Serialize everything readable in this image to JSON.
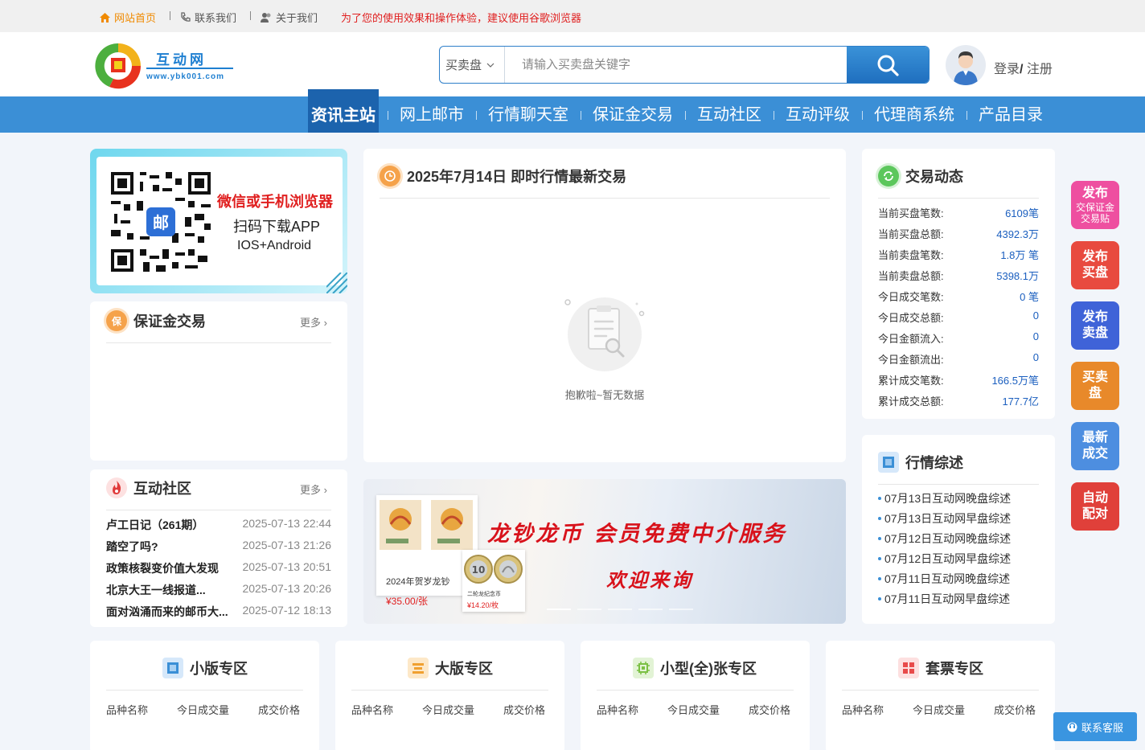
{
  "topbar": {
    "home": "网站首页",
    "contact": "联系我们",
    "about": "关于我们",
    "notice": "为了您的使用效果和操作体验，建议使用谷歌浏览器"
  },
  "logo": {
    "name": "互动网",
    "url": "www.ybk001.com"
  },
  "search": {
    "scope": "买卖盘",
    "placeholder": "请输入买卖盘关键字"
  },
  "user": {
    "login": "登录",
    "sep": "/",
    "register": "注册"
  },
  "nav": [
    "资讯主站",
    "网上邮市",
    "行情聊天室",
    "保证金交易",
    "互动社区",
    "互动评级",
    "代理商系统",
    "产品目录"
  ],
  "qr_card": {
    "line1": "微信或手机浏览器",
    "line2": "扫码下载APP",
    "line3": "IOS+Android"
  },
  "margin_trade": {
    "title": "保证金交易",
    "more": "更多",
    "icon_text": "保"
  },
  "community": {
    "title": "互动社区",
    "more": "更多",
    "posts": [
      {
        "title": "卢工日记（261期）",
        "date": "2025-07-13 22:44"
      },
      {
        "title": "踏空了吗?",
        "date": "2025-07-13 21:26"
      },
      {
        "title": "政策核裂变价值大发现",
        "date": "2025-07-13 20:51"
      },
      {
        "title": "北京大王一线报道...",
        "date": "2025-07-13 20:26"
      },
      {
        "title": "面对汹涌而来的邮币大...",
        "date": "2025-07-12 18:13"
      }
    ]
  },
  "realtime": {
    "title": "2025年7月14日 即时行情最新交易",
    "empty": "抱歉啦~暂无数据"
  },
  "trade_stats": {
    "title": "交易动态",
    "rows": [
      {
        "k": "当前买盘笔数:",
        "v": "6109笔"
      },
      {
        "k": "当前买盘总额:",
        "v": "4392.3万"
      },
      {
        "k": "当前卖盘笔数:",
        "v": "1.8万 笔"
      },
      {
        "k": "当前卖盘总额:",
        "v": "5398.1万"
      },
      {
        "k": "今日成交笔数:",
        "v": "0 笔"
      },
      {
        "k": "今日成交总额:",
        "v": "0"
      },
      {
        "k": "今日金额流入:",
        "v": "0"
      },
      {
        "k": "今日金额流出:",
        "v": "0"
      },
      {
        "k": "累计成交笔数:",
        "v": "166.5万笔"
      },
      {
        "k": "累计成交总额:",
        "v": "177.7亿"
      }
    ]
  },
  "market_review": {
    "title": "行情综述",
    "items": [
      "07月13日互动网晚盘综述",
      "07月13日互动网早盘综述",
      "07月12日互动网晚盘综述",
      "07月12日互动网早盘综述",
      "07月11日互动网晚盘综述",
      "07月11日互动网早盘综述"
    ]
  },
  "banner": {
    "headline": "龙钞龙币 会员免费中介服务",
    "sub": "欢迎来询",
    "item1_name": "2024年贺岁龙钞",
    "item1_price": "¥35.00/张",
    "item2_name": "二轮龙纪念币",
    "item2_price": "¥14.20/枚",
    "coin_value": "10"
  },
  "side_buttons": [
    {
      "line1": "发布",
      "line2": "交保证金交易贴",
      "color": "#ee4fa0"
    },
    {
      "line1": "发布",
      "line2": "买盘",
      "color": "#e84a3f"
    },
    {
      "line1": "发布",
      "line2": "卖盘",
      "color": "#3f63d8"
    },
    {
      "line1": "买卖",
      "line2": "盘",
      "color": "#e8892a"
    },
    {
      "line1": "最新",
      "line2": "成交",
      "color": "#4d8ee0"
    },
    {
      "line1": "自动",
      "line2": "配对",
      "color": "#e0403a"
    }
  ],
  "zones": [
    {
      "title": "小版专区",
      "cols": [
        "品种名称",
        "今日成交量",
        "成交价格"
      ],
      "color": "#3a8fd6"
    },
    {
      "title": "大版专区",
      "cols": [
        "品种名称",
        "今日成交量",
        "成交价格"
      ],
      "color": "#f0a030"
    },
    {
      "title": "小型(全)张专区",
      "cols": [
        "品种名称",
        "今日成交量",
        "成交价格"
      ],
      "color": "#7bc043"
    },
    {
      "title": "套票专区",
      "cols": [
        "品种名称",
        "今日成交量",
        "成交价格"
      ],
      "color": "#e84a4a"
    }
  ],
  "customer_service": "联系客服"
}
